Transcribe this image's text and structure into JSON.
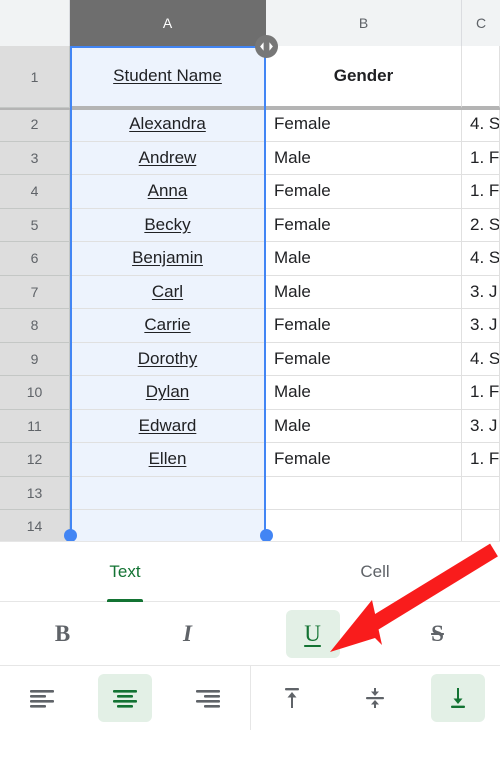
{
  "spreadsheet": {
    "column_headers": [
      "A",
      "B",
      "C"
    ],
    "selected_column": "A",
    "resize_grip_icon": "resize-columns-icon",
    "row_numbers": [
      "1",
      "2",
      "3",
      "4",
      "5",
      "6",
      "7",
      "8",
      "9",
      "10",
      "11",
      "12",
      "13",
      "14"
    ],
    "header_row": {
      "a": "Student Name",
      "b": "Gender",
      "c": ""
    },
    "rows": [
      {
        "n": "2",
        "a": "Alexandra",
        "b": "Female",
        "c": "4. S"
      },
      {
        "n": "3",
        "a": "Andrew",
        "b": "Male",
        "c": "1. F"
      },
      {
        "n": "4",
        "a": "Anna",
        "b": "Female",
        "c": "1. F"
      },
      {
        "n": "5",
        "a": "Becky",
        "b": "Female",
        "c": "2. S"
      },
      {
        "n": "6",
        "a": "Benjamin",
        "b": "Male",
        "c": "4. S"
      },
      {
        "n": "7",
        "a": "Carl",
        "b": "Male",
        "c": "3. J"
      },
      {
        "n": "8",
        "a": "Carrie",
        "b": "Female",
        "c": "3. J"
      },
      {
        "n": "9",
        "a": "Dorothy",
        "b": "Female",
        "c": "4. S"
      },
      {
        "n": "10",
        "a": "Dylan",
        "b": "Male",
        "c": "1. F"
      },
      {
        "n": "11",
        "a": "Edward",
        "b": "Male",
        "c": "3. J"
      },
      {
        "n": "12",
        "a": "Ellen",
        "b": "Female",
        "c": "1. F"
      },
      {
        "n": "13",
        "a": "",
        "b": "",
        "c": ""
      },
      {
        "n": "14",
        "a": "",
        "b": "",
        "c": ""
      }
    ]
  },
  "format_panel": {
    "tabs": [
      {
        "label": "Text",
        "active": true
      },
      {
        "label": "Cell",
        "active": false
      }
    ],
    "text_style_buttons": [
      {
        "name": "bold-button",
        "label": "B",
        "active": false
      },
      {
        "name": "italic-button",
        "label": "I",
        "active": false
      },
      {
        "name": "underline-button",
        "label": "U",
        "active": true
      },
      {
        "name": "strikethrough-button",
        "label": "S",
        "active": false
      }
    ],
    "horizontal_align_buttons": [
      {
        "name": "align-left-icon",
        "active": false
      },
      {
        "name": "align-center-icon",
        "active": true
      },
      {
        "name": "align-right-icon",
        "active": false
      }
    ],
    "vertical_align_buttons": [
      {
        "name": "align-top-icon",
        "active": false
      },
      {
        "name": "align-middle-icon",
        "active": false
      },
      {
        "name": "align-bottom-icon",
        "active": true
      }
    ]
  },
  "annotation": {
    "arrow_color": "#f91c1c",
    "arrow_target": "underline-button"
  },
  "colors": {
    "accent_green": "#137333",
    "active_bg": "#e3f0e6",
    "selection_blue": "#4285f4",
    "selection_fill": "#edf3fd",
    "header_gray": "#f1f3f4",
    "selected_header_gray": "#6e6e6e",
    "row_header_gray": "#dddddd"
  }
}
